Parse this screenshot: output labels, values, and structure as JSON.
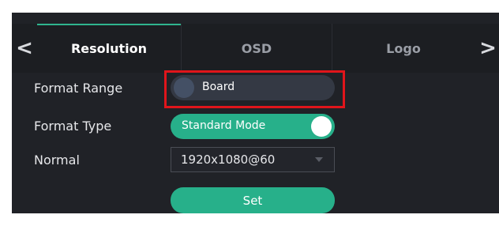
{
  "tabs": {
    "prev_arrow": "<",
    "next_arrow": ">",
    "items": [
      {
        "label": "Resolution",
        "active": true
      },
      {
        "label": "OSD",
        "active": false
      },
      {
        "label": "Logo",
        "active": false
      }
    ]
  },
  "format_range": {
    "label": "Format Range",
    "value": "Board",
    "state": "off"
  },
  "format_type": {
    "label": "Format Type",
    "value": "Standard Mode",
    "state": "on"
  },
  "normal": {
    "label": "Normal",
    "selected": "1920x1080@60"
  },
  "set_button": {
    "label": "Set"
  },
  "colors": {
    "accent": "#27b08a",
    "highlight_border": "#e0151b",
    "panel_bg": "#202227",
    "toggle_off_bg": "#343944"
  },
  "icons": {
    "prev": "chevron-left-icon",
    "next": "chevron-right-icon",
    "dropdown": "caret-down-icon"
  }
}
